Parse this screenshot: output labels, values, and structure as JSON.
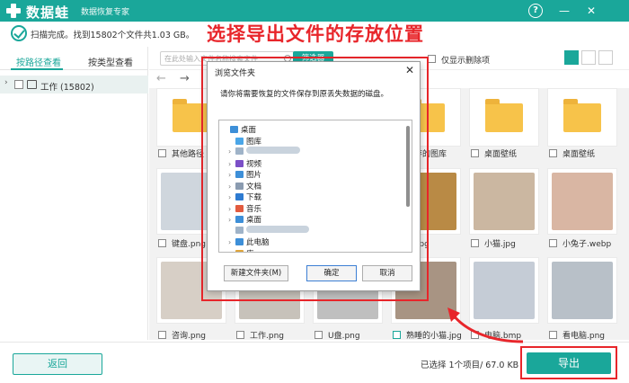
{
  "app": {
    "title": "数据蛙",
    "subtitle": "数据恢复专家"
  },
  "titlebar": {
    "help": "?",
    "minimize": "—",
    "close": "✕"
  },
  "status": {
    "text": "扫描完成。找到15802个文件共1.03 GB。"
  },
  "headline": "选择导出文件的存放位置",
  "sidebar": {
    "tabs": [
      {
        "label": "按路径查看",
        "active": true
      },
      {
        "label": "按类型查看",
        "active": false
      }
    ],
    "tree": {
      "arrow": "›",
      "label": "工作 (15802)"
    }
  },
  "toolbar": {
    "search_placeholder": "在此处输入文件名称搜索文件",
    "filter_label": "筛选器",
    "only_deleted_label": "仅显示删除项"
  },
  "grid": {
    "rows": [
      [
        {
          "type": "folder",
          "label": "其他路径",
          "checked": false
        },
        {
          "type": "hidden",
          "label": "",
          "checked": false
        },
        {
          "type": "hidden",
          "label": "",
          "checked": false
        },
        {
          "type": "folder",
          "label": "保存的图库",
          "checked": false
        },
        {
          "type": "folder",
          "label": "桌面壁纸",
          "checked": false
        },
        {
          "type": "folder",
          "label": "桌面壁纸",
          "checked": false
        }
      ],
      [
        {
          "type": "image",
          "label": "键盘.png",
          "color": "#cfd6dd",
          "checked": false
        },
        {
          "type": "hidden",
          "label": "",
          "checked": false
        },
        {
          "type": "hidden",
          "label": "",
          "checked": false
        },
        {
          "type": "image",
          "label": "花.jpg",
          "color": "#b98a45",
          "checked": false
        },
        {
          "type": "image",
          "label": "小猫.jpg",
          "color": "#cbb7a1",
          "checked": false
        },
        {
          "type": "image",
          "label": "小兔子.webp",
          "color": "#d9b6a3",
          "checked": false
        }
      ],
      [
        {
          "type": "image",
          "label": "咨询.png",
          "color": "#d7cfc6",
          "checked": false
        },
        {
          "type": "image",
          "label": "工作.png",
          "color": "#c7c2ba",
          "checked": false
        },
        {
          "type": "image",
          "label": "U盘.png",
          "color": "#bfbfbf",
          "checked": false
        },
        {
          "type": "image",
          "label": "熟睡的小猫.jpg",
          "color": "#a89483",
          "checked": true
        },
        {
          "type": "image",
          "label": "电脑.bmp",
          "color": "#c5ccd6",
          "checked": false
        },
        {
          "type": "image",
          "label": "看电脑.png",
          "color": "#b8c0c8",
          "checked": false
        }
      ]
    ]
  },
  "dialog": {
    "title": "浏览文件夹",
    "close": "✕",
    "prompt": "请你将需要恢复的文件保存到原丢失数据的磁盘。",
    "tree": [
      {
        "label": "桌面",
        "icon": "desktop-icon",
        "color": "#3d8fd8",
        "indent": 0,
        "chev": false
      },
      {
        "label": "图库",
        "icon": "gallery-icon",
        "color": "#4aa6e8",
        "indent": 1,
        "chev": false
      },
      {
        "label": "",
        "icon": "blurred-item",
        "color": "#9fb3c8",
        "indent": 1,
        "chev": true
      },
      {
        "label": "视频",
        "icon": "video-icon",
        "color": "#7b4fc7",
        "indent": 1,
        "chev": true
      },
      {
        "label": "图片",
        "icon": "picture-icon",
        "color": "#3d8fd8",
        "indent": 1,
        "chev": true
      },
      {
        "label": "文档",
        "icon": "document-icon",
        "color": "#8a9bb0",
        "indent": 1,
        "chev": true
      },
      {
        "label": "下载",
        "icon": "download-icon",
        "color": "#2e7bd1",
        "indent": 1,
        "chev": true
      },
      {
        "label": "音乐",
        "icon": "music-icon",
        "color": "#e25b3f",
        "indent": 1,
        "chev": true
      },
      {
        "label": "桌面",
        "icon": "desktop-icon",
        "color": "#3d8fd8",
        "indent": 1,
        "chev": true
      },
      {
        "label": "",
        "icon": "blurred-item",
        "color": "#9fb3c8",
        "indent": 1,
        "chev": false
      },
      {
        "label": "此电脑",
        "icon": "computer-icon",
        "color": "#3d8fd8",
        "indent": 1,
        "chev": true
      },
      {
        "label": "库",
        "icon": "library-icon",
        "color": "#e0a53a",
        "indent": 1,
        "chev": true
      }
    ],
    "buttons": {
      "new_folder": "新建文件夹(M)",
      "ok": "确定",
      "cancel": "取消"
    }
  },
  "footer": {
    "back": "返回",
    "selection": "已选择 1个项目/ 67.0 KB",
    "export": "导出"
  },
  "colors": {
    "accent": "#1aa79a",
    "highlight": "#e8262b"
  }
}
